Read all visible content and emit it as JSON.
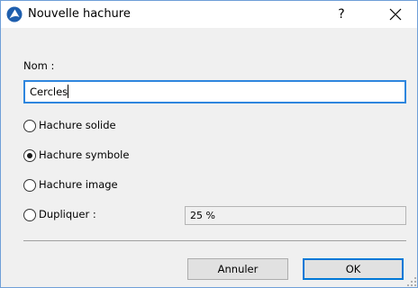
{
  "dialog": {
    "title": "Nouvelle hachure",
    "help_label": "?",
    "close_icon": "close-icon",
    "app_icon": "archicad-icon"
  },
  "name": {
    "label": "Nom :",
    "value": "Cercles"
  },
  "options": [
    {
      "label": "Hachure solide",
      "checked": false
    },
    {
      "label": "Hachure symbole",
      "checked": true
    },
    {
      "label": "Hachure image",
      "checked": false
    },
    {
      "label": "Dupliquer :",
      "checked": false
    }
  ],
  "duplicate": {
    "value": "25 %"
  },
  "buttons": {
    "cancel": "Annuler",
    "ok": "OK"
  },
  "colors": {
    "accent": "#2e86de",
    "border": "#6f9fd8",
    "background": "#f0f0f0"
  }
}
